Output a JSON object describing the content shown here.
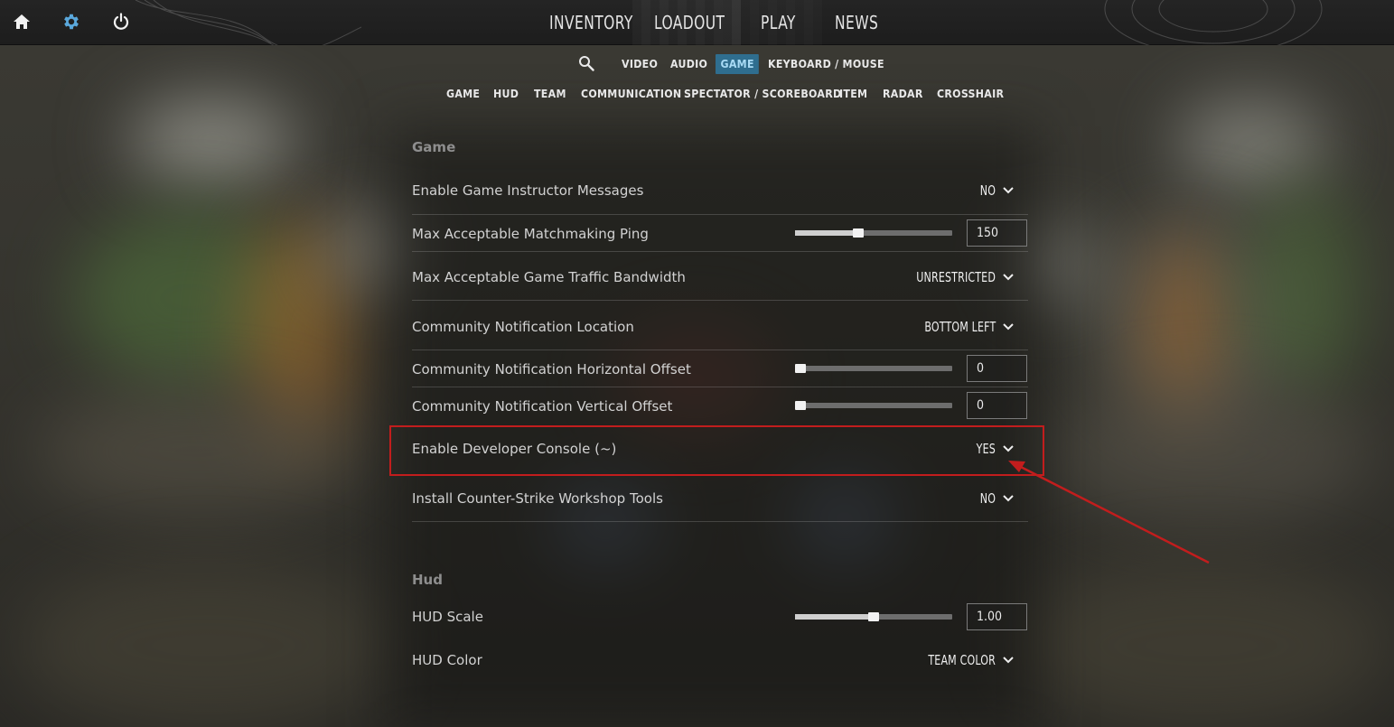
{
  "colors": {
    "accent_tab_bg": "#2f6e8f",
    "accent_tab_text": "#a9dbf5",
    "gear_icon": "#5aa8dc",
    "highlight_border": "#c21d1d"
  },
  "top_icons": [
    "home-icon",
    "gear-icon",
    "power-icon"
  ],
  "main_nav": {
    "items": [
      "INVENTORY",
      "LOADOUT",
      "PLAY",
      "NEWS"
    ]
  },
  "settings_tabs": {
    "search_icon": "search-icon",
    "items": [
      "VIDEO",
      "AUDIO",
      "GAME",
      "KEYBOARD / MOUSE"
    ],
    "active": "GAME"
  },
  "category_tabs": {
    "items": [
      "GAME",
      "HUD",
      "TEAM",
      "COMMUNICATION",
      "SPECTATOR / SCOREBOARD",
      "ITEM",
      "RADAR",
      "CROSSHAIR"
    ]
  },
  "sections": {
    "game": {
      "title": "Game",
      "rows": [
        {
          "label": "Enable Game Instructor Messages",
          "type": "dropdown",
          "value": "NO"
        },
        {
          "label": "Max Acceptable Matchmaking Ping",
          "type": "slider",
          "value": "150",
          "level": 0.4
        },
        {
          "label": "Max Acceptable Game Traffic Bandwidth",
          "type": "dropdown",
          "value": "UNRESTRICTED"
        },
        {
          "label": "Community Notification Location",
          "type": "dropdown",
          "value": "BOTTOM LEFT"
        },
        {
          "label": "Community Notification Horizontal Offset",
          "type": "slider",
          "value": "0",
          "level": 0.0
        },
        {
          "label": "Community Notification Vertical Offset",
          "type": "slider",
          "value": "0",
          "level": 0.0
        },
        {
          "label": "Enable Developer Console (~)",
          "type": "dropdown",
          "value": "YES"
        },
        {
          "label": "Install Counter-Strike Workshop Tools",
          "type": "dropdown",
          "value": "NO"
        }
      ]
    },
    "hud": {
      "title": "Hud",
      "rows": [
        {
          "label": "HUD Scale",
          "type": "slider",
          "value": "1.00",
          "level": 0.5
        },
        {
          "label": "HUD Color",
          "type": "dropdown",
          "value": "TEAM COLOR"
        }
      ]
    }
  }
}
